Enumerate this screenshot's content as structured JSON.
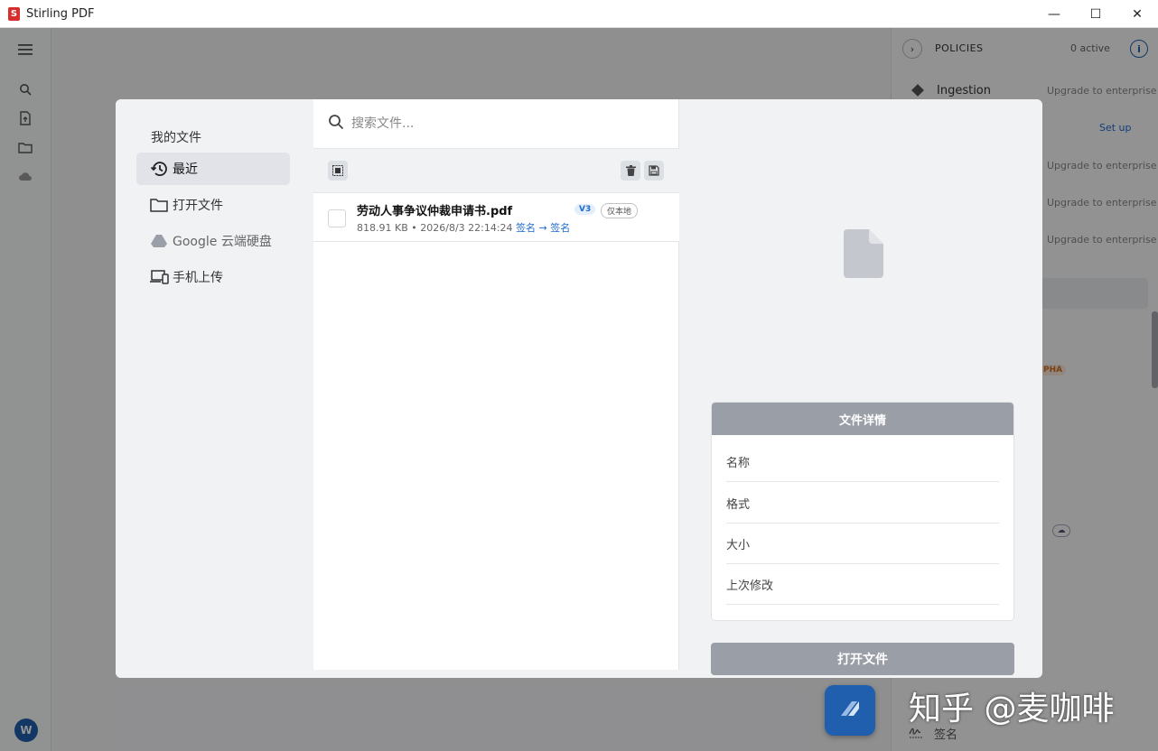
{
  "window": {
    "title": "Stirling PDF",
    "logo_letter": "S",
    "minimize": "—",
    "maximize": "☐",
    "close": "✕"
  },
  "rail": {
    "avatar_letter": "W"
  },
  "right_panel": {
    "policies_label": "POLICIES",
    "active_count": "0 active",
    "ingestion_label": "Ingestion",
    "upgrade_text": "Upgrade to enterprise",
    "setup_label": "Set up",
    "alpha_badge": "PHA"
  },
  "modal": {
    "sidebar": {
      "title": "我的文件",
      "items": [
        {
          "label": "最近",
          "icon": "history-icon",
          "active": true
        },
        {
          "label": "打开文件",
          "icon": "folder-icon",
          "active": false
        },
        {
          "label": "Google 云端硬盘",
          "icon": "google-drive-icon",
          "active": false
        },
        {
          "label": "手机上传",
          "icon": "devices-icon",
          "active": false
        }
      ]
    },
    "search": {
      "placeholder": "搜索文件..."
    },
    "files": [
      {
        "name": "劳动人事争议仲裁申请书.pdf",
        "version": "V3",
        "storage": "仅本地",
        "size": "818.91 KB",
        "date": "2026/8/3 22:14:24",
        "history": "签名 → 签名"
      }
    ],
    "details": {
      "title": "文件详情",
      "rows": [
        "名称",
        "格式",
        "大小",
        "上次修改"
      ]
    },
    "open_button": "打开文件"
  },
  "bottom": {
    "sign_label": "签名",
    "watermark": "知乎 @麦咖啡"
  }
}
